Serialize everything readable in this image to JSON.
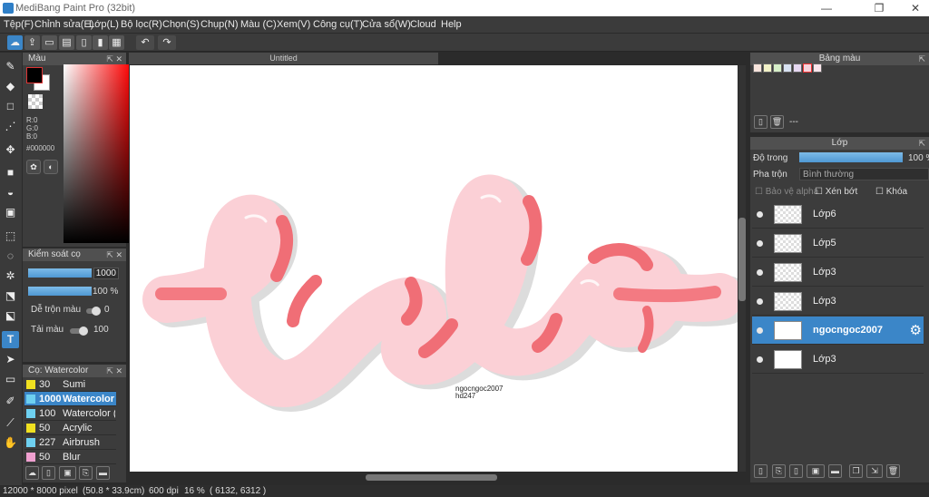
{
  "window": {
    "title": "MediBang Paint Pro (32bit)",
    "minimize": "—",
    "restore": "❐",
    "close": "✕"
  },
  "menu": [
    "Tệp(F)",
    "Chỉnh sửa(E)",
    "Lớp(L)",
    "Bộ lọc(R)",
    "Chọn(S)",
    "Chụp(N)",
    "Màu (C)",
    "Xem(V)",
    "Công cụ(T)",
    "Cửa sổ(W)",
    "Cloud",
    "Help"
  ],
  "toolbar": {
    "undo_icon": "↶",
    "redo_icon": "↷"
  },
  "color_panel": {
    "title": "Màu",
    "r": "R:0",
    "g": "G:0",
    "b": "B:0",
    "hex": "#000000"
  },
  "brush_control": {
    "title": "Kiểm soát cọ",
    "size": "1000",
    "opacity": "100 %",
    "blend_label": "Dễ trộn màu",
    "blend_value": "0",
    "load_label": "Tải màu",
    "load_value": "100"
  },
  "brush_list": {
    "title": "Cọ: Watercolor",
    "items": [
      {
        "size": "30",
        "name": "Sumi",
        "color": "#f0e020"
      },
      {
        "size": "1000",
        "name": "Watercolor",
        "color": "#6ed0f0"
      },
      {
        "size": "100",
        "name": "Watercolor (",
        "color": "#6ed0f0"
      },
      {
        "size": "50",
        "name": "Acrylic",
        "color": "#f0e020"
      },
      {
        "size": "227",
        "name": "Airbrush",
        "color": "#6ed0f0"
      },
      {
        "size": "50",
        "name": "Blur",
        "color": "#f0a0d0"
      }
    ]
  },
  "document": {
    "tab": "Untitled",
    "signature_line1": "ngocngoc2007",
    "signature_line2": "hd247"
  },
  "palette_panel": {
    "title": "Bảng màu",
    "swatches": [
      "#f7e4dc",
      "#f2f2c8",
      "#d6eec8",
      "#d8e2f2",
      "#e6d8f2",
      "#f6d2dc",
      "#fbe6ec"
    ],
    "dash": "---"
  },
  "layer_panel": {
    "title": "Lớp",
    "opacity_label": "Độ trong",
    "opacity_value": "100 %",
    "blend_label": "Pha trộn",
    "blend_value": "Bình thường",
    "protect_alpha": "Bảo vệ alpha",
    "clipping": "Xén bớt",
    "lock": "Khóa",
    "layers": [
      {
        "name": "Lớp6",
        "selected": false
      },
      {
        "name": "Lớp5",
        "selected": false
      },
      {
        "name": "Lớp3",
        "selected": false
      },
      {
        "name": "Lớp3",
        "selected": false
      },
      {
        "name": "ngocngoc2007",
        "selected": true
      },
      {
        "name": "Lớp3",
        "selected": false
      }
    ]
  },
  "status": {
    "size": "12000 * 8000 pixel",
    "cm": "(50.8 * 33.9cm)",
    "dpi": "600 dpi",
    "zoom": "16 %",
    "coords": "( 6132, 6312 )"
  }
}
